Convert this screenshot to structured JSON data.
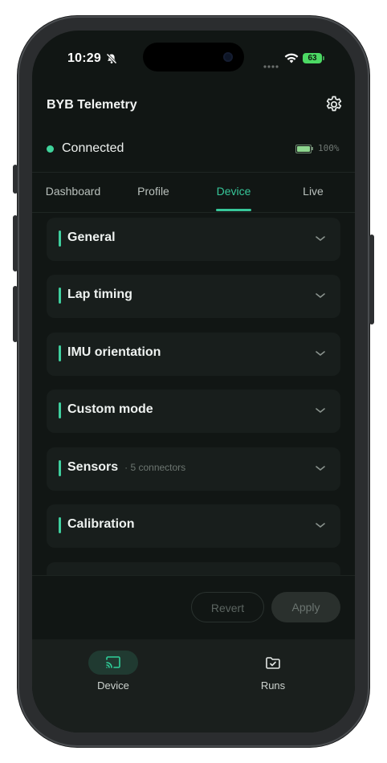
{
  "status_bar": {
    "time": "10:29",
    "battery": "63"
  },
  "app": {
    "title": "BYB Telemetry"
  },
  "connection": {
    "status": "Connected",
    "battery_pct": "100%",
    "battery_level": 1.0
  },
  "tabs": [
    {
      "label": "Dashboard",
      "active": false
    },
    {
      "label": "Profile",
      "active": false
    },
    {
      "label": "Device",
      "active": true
    },
    {
      "label": "Live",
      "active": false
    }
  ],
  "sections": [
    {
      "title": "General",
      "meta": ""
    },
    {
      "title": "Lap timing",
      "meta": ""
    },
    {
      "title": "IMU orientation",
      "meta": ""
    },
    {
      "title": "Custom mode",
      "meta": ""
    },
    {
      "title": "Sensors",
      "meta": "· 5 connectors"
    },
    {
      "title": "Calibration",
      "meta": ""
    }
  ],
  "actions": {
    "revert_label": "Revert",
    "apply_label": "Apply"
  },
  "bottom_nav": [
    {
      "label": "Device",
      "icon": "cast-icon",
      "active": true
    },
    {
      "label": "Runs",
      "icon": "folder-check-icon",
      "active": false
    }
  ],
  "colors": {
    "accent": "#37c79a",
    "background": "#111614",
    "card": "#181e1c"
  }
}
